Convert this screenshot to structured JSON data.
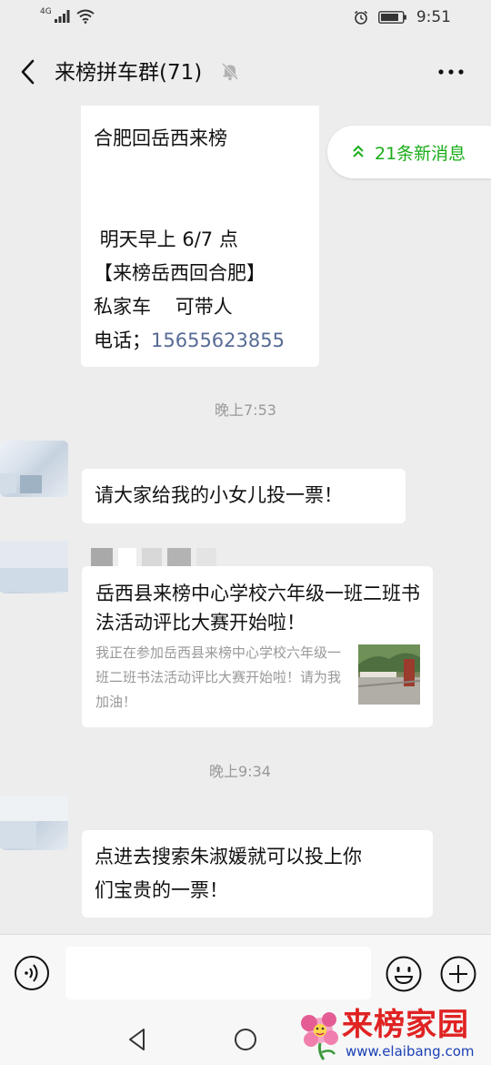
{
  "status_bar": {
    "network": "4G",
    "time": "9:51"
  },
  "header": {
    "title": "来榜拼车群(71)",
    "icons": [
      "back-icon",
      "mute-bell-icon",
      "more-icon"
    ]
  },
  "new_messages_pill": {
    "label": "21条新消息"
  },
  "messages": {
    "carpool": {
      "line1": "合肥回岳西来榜",
      "line2": " 明天早上 6/7 点",
      "line3": "【来榜岳西回合肥】",
      "line4": "私家车    可带人",
      "phone_prefix": "电话；",
      "phone": "15655623855"
    },
    "time1": "晚上7:53",
    "vote": "请大家给我的小女儿投一票！",
    "card": {
      "title": "岳西县来榜中心学校六年级一班二班书法活动评比大赛开始啦！",
      "description": "我正在参加岳西县来榜中心学校六年级一班二班书法活动评比大赛开始啦！请为我加油！"
    },
    "time2": "晚上9:34",
    "search": {
      "line1": "点进去搜索朱淑媛就可以投上你",
      "line2": "们宝贵的一票！"
    }
  },
  "input_bar": {
    "value": "",
    "icons": [
      "voice-icon",
      "emoji-icon",
      "plus-icon"
    ]
  },
  "watermark": {
    "title": "来榜家园",
    "url": "www.elaibang.com"
  },
  "colors": {
    "background": "#ededed",
    "bubble": "#ffffff",
    "link": "#576b95",
    "pill_text": "#1aad19",
    "timestamp": "#999999",
    "watermark_red": "#e02222",
    "watermark_blue": "#1a3fb5"
  }
}
